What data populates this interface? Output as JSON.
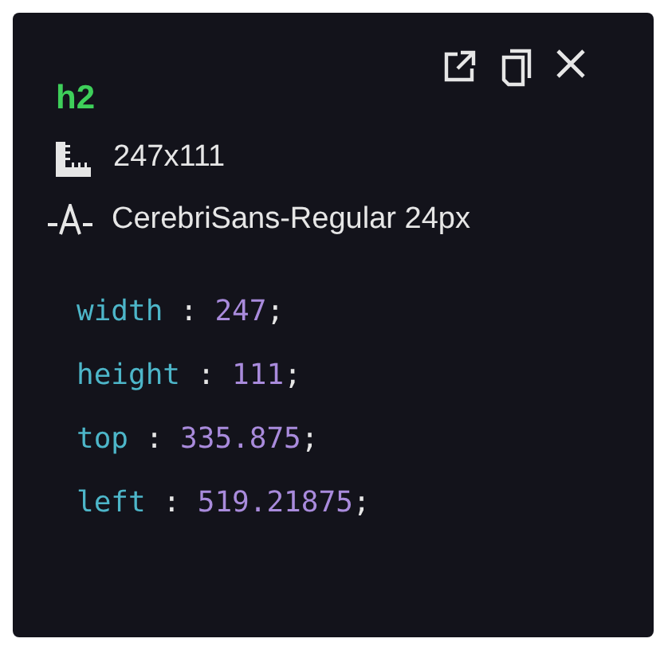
{
  "element": {
    "tag": "h2",
    "size": "247x111",
    "font": "CerebriSans-Regular 24px"
  },
  "styles": [
    {
      "property": "width",
      "separator": ":",
      "value": "247",
      "terminator": ";"
    },
    {
      "property": "height",
      "separator": ":",
      "value": "111",
      "terminator": ";"
    },
    {
      "property": "top",
      "separator": ":",
      "value": "335.875",
      "terminator": ";"
    },
    {
      "property": "left",
      "separator": ":",
      "value": "519.21875",
      "terminator": ";"
    }
  ]
}
